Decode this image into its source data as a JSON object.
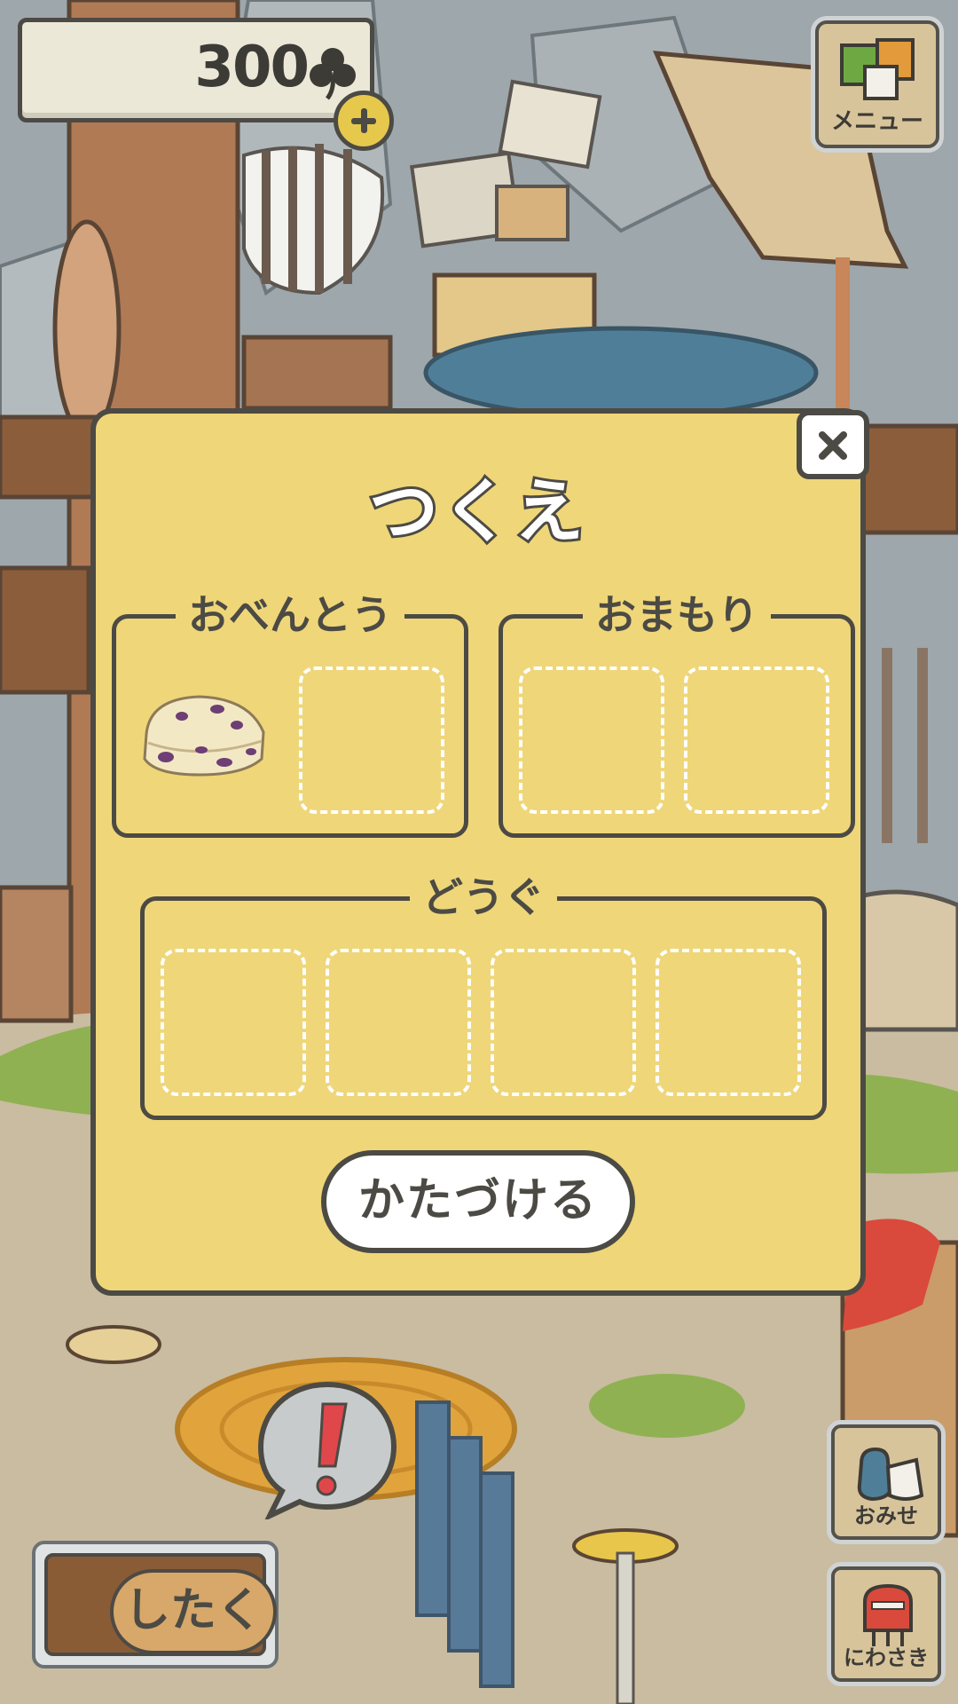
{
  "clover": {
    "count": "300",
    "icon": "clover-icon"
  },
  "menu": {
    "label": "メニュー"
  },
  "dialog": {
    "title": "つくえ",
    "sections": {
      "bento": {
        "label": "おべんとう"
      },
      "charm": {
        "label": "おまもり"
      },
      "tools": {
        "label": "どうぐ"
      }
    },
    "tidy_button": "かたづける"
  },
  "bottom": {
    "prepare": "したく",
    "shop": "おみせ",
    "garden": "にわさき"
  },
  "colors": {
    "dialog_bg": "#efd679",
    "outline": "#4c4a44",
    "alert": "#e0474b"
  }
}
